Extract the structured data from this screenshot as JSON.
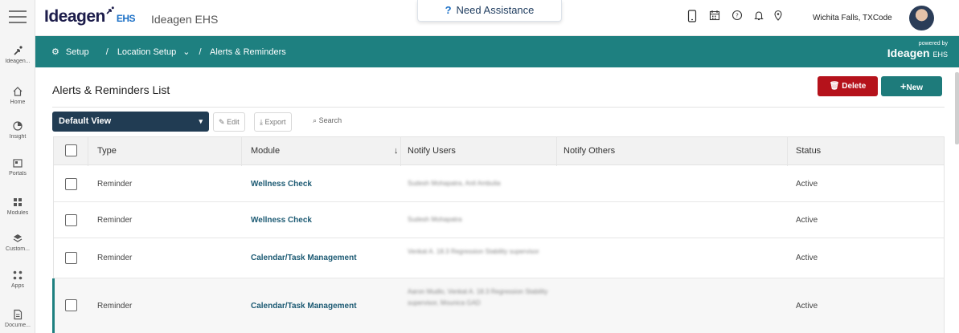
{
  "rail": {
    "items": [
      {
        "label": "Ideagen...",
        "icon": "ideagen-icon"
      },
      {
        "label": "Home",
        "icon": "home-icon"
      },
      {
        "label": "Insight",
        "icon": "insight-icon"
      },
      {
        "label": "Portals",
        "icon": "portals-icon"
      },
      {
        "label": "Modules",
        "icon": "modules-icon"
      },
      {
        "label": "Custom...",
        "icon": "custom-icon"
      },
      {
        "label": "Apps",
        "icon": "apps-icon"
      },
      {
        "label": "Docume...",
        "icon": "document-icon"
      }
    ]
  },
  "header": {
    "logo_text": "Ideagen",
    "logo_suffix": "EHS",
    "app_name": "Ideagen EHS",
    "assistance_label": "Need Assistance",
    "location": "Wichita Falls, TXCode"
  },
  "breadcrumb": {
    "setup": "Setup",
    "sep1": "/",
    "location_setup": "Location Setup",
    "sep2": "/",
    "current": "Alerts & Reminders",
    "powered_by": "powered by",
    "powered_logo": "Ideagen",
    "powered_suffix": "EHS"
  },
  "list": {
    "title": "Alerts & Reminders List",
    "delete_label": "Delete",
    "new_label": "New",
    "view_label": "Default View",
    "edit_label": "Edit",
    "export_label": "Export",
    "search_label": "Search"
  },
  "table": {
    "columns": [
      "Type",
      "Module",
      "Notify Users",
      "Notify Others",
      "Status"
    ],
    "rows": [
      {
        "type": "Reminder",
        "module": "Wellness Check",
        "notify_users": "Sudesh Mohapatra, Anil Ambulia",
        "notify_others": "",
        "status": "Active"
      },
      {
        "type": "Reminder",
        "module": "Wellness Check",
        "notify_users": "Sudesh Mohapatra",
        "notify_others": "",
        "status": "Active"
      },
      {
        "type": "Reminder",
        "module": "Calendar/Task Management",
        "notify_users": "Venkat A. 18.3 Regression Stability supervisor",
        "notify_others": "",
        "status": "Active"
      },
      {
        "type": "Reminder",
        "module": "Calendar/Task Management",
        "notify_users": "Aaron Mudlo, Venkat A. 18.3 Regression Stability supervisor, Mounica GAD",
        "notify_others": "",
        "status": "Active"
      }
    ]
  },
  "colors": {
    "teal": "#1e8080",
    "navy": "#213c53",
    "danger": "#b5121b",
    "link": "#1c5a73"
  }
}
